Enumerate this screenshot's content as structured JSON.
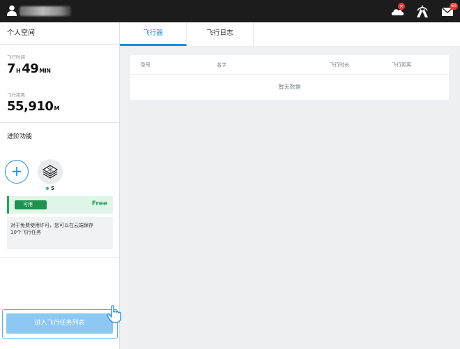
{
  "topbar": {
    "icons": [
      "user-icon",
      "cloud-icon",
      "antenna-icon",
      "mail-icon"
    ],
    "cloud_badge": "×",
    "mail_badge": "60"
  },
  "sidebar": {
    "title": "个人空间",
    "flight_time": {
      "label": "飞行时间",
      "hours": "7",
      "hours_unit": "H",
      "minutes": "49",
      "minutes_unit": "MIN"
    },
    "flight_distance": {
      "label": "飞行距离",
      "value": "55,910",
      "unit": "M"
    },
    "advanced": {
      "title": "进阶功能",
      "add_symbol": "+",
      "layer_count": "5"
    },
    "license": {
      "status": "可用",
      "plan": "Free",
      "note_line1": "对于免费使用许可，您可以在云端保存",
      "note_line2": "10个飞行任务"
    },
    "enter_button": "进入飞行任务列表"
  },
  "main": {
    "tabs": [
      {
        "label": "飞行器",
        "active": true
      },
      {
        "label": "飞行日志",
        "active": false
      }
    ],
    "table": {
      "columns": [
        "型号",
        "名字",
        "飞行时长",
        "飞行距离"
      ],
      "empty_text": "暂无数据"
    }
  },
  "colors": {
    "accent": "#1a8fe3",
    "topbar": "#1c1c1c",
    "success": "#27a55a",
    "badge": "#e53935"
  }
}
